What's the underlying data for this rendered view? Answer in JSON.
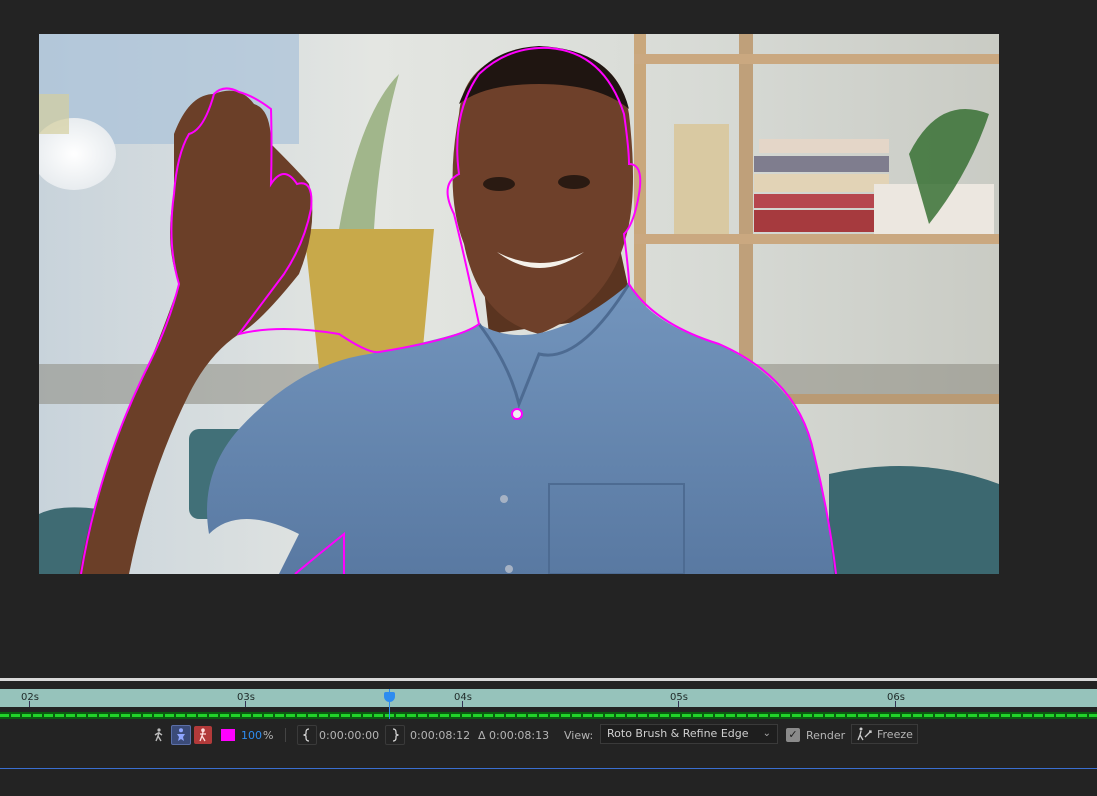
{
  "ruler": {
    "ticks": [
      "02s",
      "03s",
      "04s",
      "05s",
      "06s"
    ]
  },
  "toolbar": {
    "color_swatch": "#ff00ff",
    "opacity_value": "100",
    "opacity_unit": "%",
    "start_time": "0:00:00:00",
    "end_time": "0:00:08:12",
    "duration": "Δ 0:00:08:13",
    "view_label": "View:",
    "view_value": "Roto Brush & Refine Edge",
    "render_label": "Render",
    "render_checked": true,
    "freeze_label": "Freeze"
  },
  "colors": {
    "outline": "#ff00ff",
    "ruler": "#96c3bb",
    "cache": "#22d22a",
    "playhead": "#2d8cf0"
  },
  "icons": [
    "walk-icon",
    "figure-icon",
    "figure-red-icon",
    "bracket-left-icon",
    "bracket-right-icon",
    "caret-down-icon",
    "checkbox-icon",
    "freeze-icon"
  ]
}
